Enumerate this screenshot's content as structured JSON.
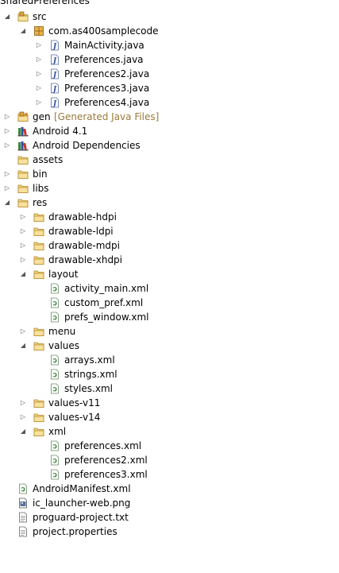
{
  "root": "SharedPreferences",
  "nodes": [
    {
      "label": "src",
      "icon": "package-folder",
      "depth": 0,
      "state": "open"
    },
    {
      "label": "com.as400samplecode",
      "icon": "package",
      "depth": 1,
      "state": "open"
    },
    {
      "label": "MainActivity.java",
      "icon": "java-file",
      "depth": 2,
      "state": "closed"
    },
    {
      "label": "Preferences.java",
      "icon": "java-file",
      "depth": 2,
      "state": "closed"
    },
    {
      "label": "Preferences2.java",
      "icon": "java-file",
      "depth": 2,
      "state": "closed"
    },
    {
      "label": "Preferences3.java",
      "icon": "java-file",
      "depth": 2,
      "state": "closed"
    },
    {
      "label": "Preferences4.java",
      "icon": "java-file",
      "depth": 2,
      "state": "closed"
    },
    {
      "label": "gen",
      "decor": "[Generated Java Files]",
      "icon": "gen-folder",
      "depth": 0,
      "state": "closed"
    },
    {
      "label": "Android 4.1",
      "icon": "library",
      "depth": 0,
      "state": "closed"
    },
    {
      "label": "Android Dependencies",
      "icon": "library",
      "depth": 0,
      "state": "closed"
    },
    {
      "label": "assets",
      "icon": "folder",
      "depth": 0,
      "state": "leaf"
    },
    {
      "label": "bin",
      "icon": "folder",
      "depth": 0,
      "state": "closed"
    },
    {
      "label": "libs",
      "icon": "folder",
      "depth": 0,
      "state": "closed"
    },
    {
      "label": "res",
      "icon": "folder",
      "depth": 0,
      "state": "open"
    },
    {
      "label": "drawable-hdpi",
      "icon": "folder",
      "depth": 1,
      "state": "closed"
    },
    {
      "label": "drawable-ldpi",
      "icon": "folder",
      "depth": 1,
      "state": "closed"
    },
    {
      "label": "drawable-mdpi",
      "icon": "folder",
      "depth": 1,
      "state": "closed"
    },
    {
      "label": "drawable-xhdpi",
      "icon": "folder",
      "depth": 1,
      "state": "closed"
    },
    {
      "label": "layout",
      "icon": "folder",
      "depth": 1,
      "state": "open"
    },
    {
      "label": "activity_main.xml",
      "icon": "xml-file",
      "depth": 2,
      "state": "leaf"
    },
    {
      "label": "custom_pref.xml",
      "icon": "xml-file",
      "depth": 2,
      "state": "leaf"
    },
    {
      "label": "prefs_window.xml",
      "icon": "xml-file",
      "depth": 2,
      "state": "leaf"
    },
    {
      "label": "menu",
      "icon": "folder",
      "depth": 1,
      "state": "closed"
    },
    {
      "label": "values",
      "icon": "folder",
      "depth": 1,
      "state": "open"
    },
    {
      "label": "arrays.xml",
      "icon": "xml-file",
      "depth": 2,
      "state": "leaf"
    },
    {
      "label": "strings.xml",
      "icon": "xml-file",
      "depth": 2,
      "state": "leaf"
    },
    {
      "label": "styles.xml",
      "icon": "xml-file",
      "depth": 2,
      "state": "leaf"
    },
    {
      "label": "values-v11",
      "icon": "folder",
      "depth": 1,
      "state": "closed"
    },
    {
      "label": "values-v14",
      "icon": "folder",
      "depth": 1,
      "state": "closed"
    },
    {
      "label": "xml",
      "icon": "folder",
      "depth": 1,
      "state": "open"
    },
    {
      "label": "preferences.xml",
      "icon": "xml-file",
      "depth": 2,
      "state": "leaf"
    },
    {
      "label": "preferences2.xml",
      "icon": "xml-file",
      "depth": 2,
      "state": "leaf"
    },
    {
      "label": "preferences3.xml",
      "icon": "xml-file",
      "depth": 2,
      "state": "leaf"
    },
    {
      "label": "AndroidManifest.xml",
      "icon": "xml-file",
      "depth": 0,
      "state": "leaf"
    },
    {
      "label": "ic_launcher-web.png",
      "icon": "image-file",
      "depth": 0,
      "state": "leaf"
    },
    {
      "label": "proguard-project.txt",
      "icon": "text-file",
      "depth": 0,
      "state": "leaf"
    },
    {
      "label": "project.properties",
      "icon": "text-file",
      "depth": 0,
      "state": "leaf"
    }
  ]
}
